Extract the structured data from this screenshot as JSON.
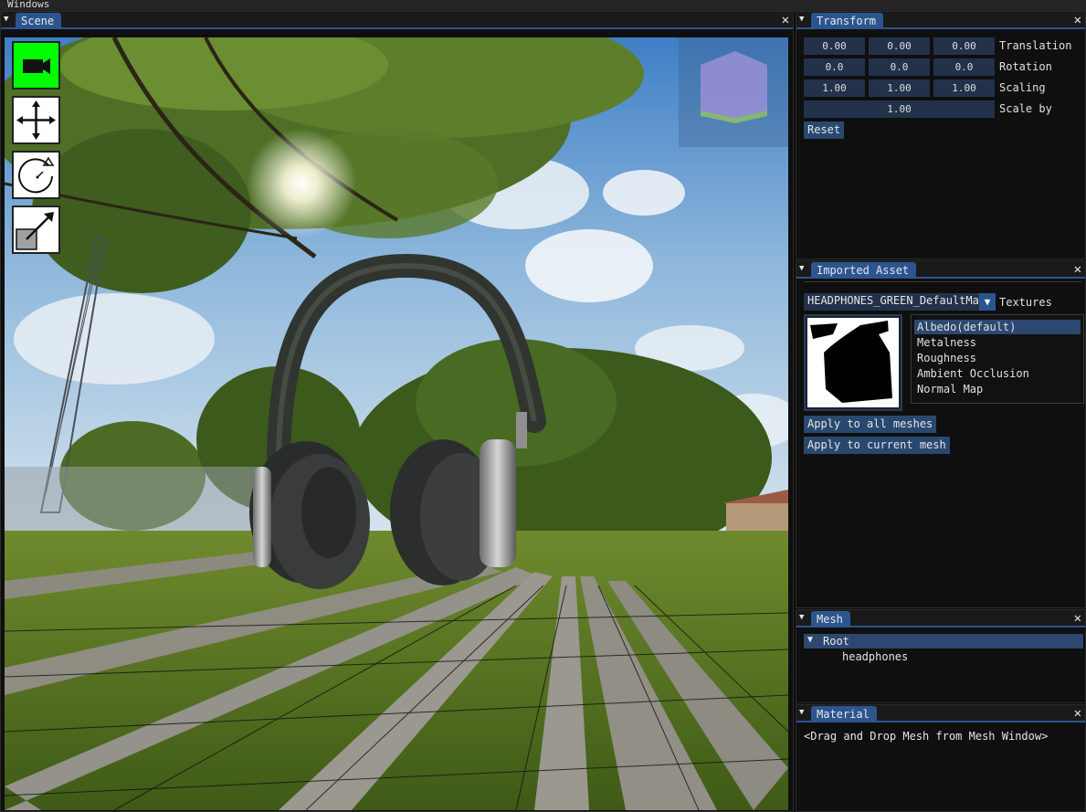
{
  "menubar": {
    "windows": "Windows"
  },
  "scene": {
    "tab": "Scene",
    "tools": [
      "camera-icon",
      "move-icon",
      "rotate-icon",
      "scale-icon"
    ]
  },
  "transform": {
    "tab": "Transform",
    "translation": {
      "label": "Translation",
      "x": "0.00",
      "y": "0.00",
      "z": "0.00"
    },
    "rotation": {
      "label": "Rotation",
      "x": "0.0",
      "y": "0.0",
      "z": "0.0"
    },
    "scaling": {
      "label": "Scaling",
      "x": "1.00",
      "y": "1.00",
      "z": "1.00"
    },
    "scale_by": {
      "label": "Scale by",
      "value": "1.00"
    },
    "reset": "Reset"
  },
  "imported_asset": {
    "tab": "Imported Asset",
    "material_select": "HEADPHONES_GREEN_DefaultMat",
    "textures_label": "Textures",
    "texture_list": [
      "Albedo(default)",
      "Metalness",
      "Roughness",
      "Ambient Occlusion",
      "Normal Map"
    ],
    "apply_all": "Apply to all meshes",
    "apply_current": "Apply to current mesh"
  },
  "mesh": {
    "tab": "Mesh",
    "root": "Root",
    "child": "headphones"
  },
  "material": {
    "tab": "Material",
    "hint": "<Drag and Drop Mesh from Mesh Window>"
  },
  "colors": {
    "accent": "#2c5590",
    "active_tool": "#00ff00",
    "field_bg": "#23324a"
  }
}
